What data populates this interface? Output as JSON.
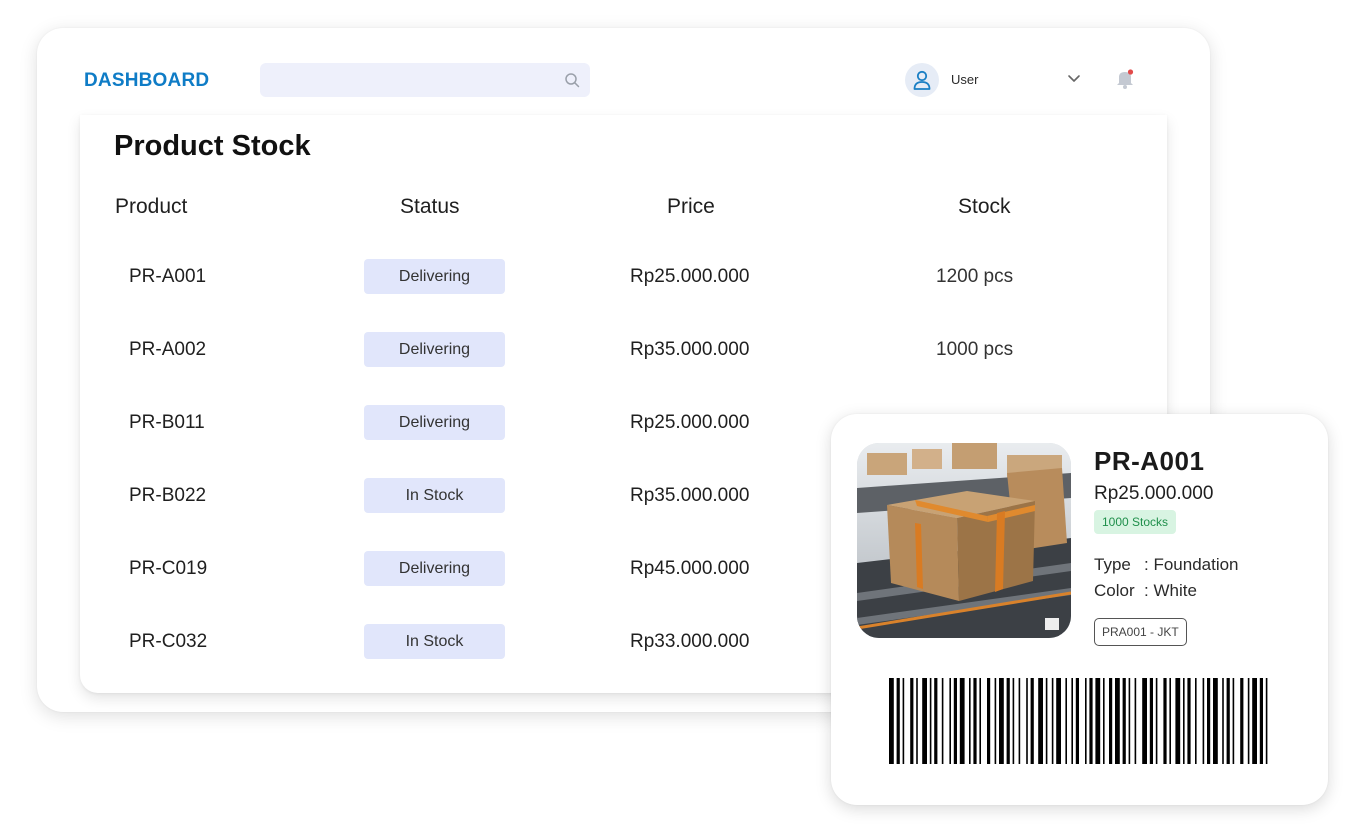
{
  "header": {
    "brand": "DASHBOARD",
    "search_placeholder": "",
    "user_name": "User"
  },
  "table": {
    "title": "Product Stock",
    "columns": [
      "Product",
      "Status",
      "Price",
      "Stock"
    ],
    "rows": [
      {
        "product": "PR-A001",
        "status": "Delivering",
        "price": "Rp25.000.000",
        "stock": "1200 pcs"
      },
      {
        "product": "PR-A002",
        "status": "Delivering",
        "price": "Rp35.000.000",
        "stock": "1000 pcs"
      },
      {
        "product": "PR-B011",
        "status": "Delivering",
        "price": "Rp25.000.000",
        "stock": ""
      },
      {
        "product": "PR-B022",
        "status": "In Stock",
        "price": "Rp35.000.000",
        "stock": ""
      },
      {
        "product": "PR-C019",
        "status": "Delivering",
        "price": "Rp45.000.000",
        "stock": ""
      },
      {
        "product": "PR-C032",
        "status": "In Stock",
        "price": "Rp33.000.000",
        "stock": ""
      }
    ]
  },
  "detail": {
    "code": "PR-A001",
    "price": "Rp25.000.000",
    "stocks_badge": "1000 Stocks",
    "type_label": "Type",
    "type_value": ": Foundation",
    "color_label": "Color",
    "color_value": ": White",
    "sku": "PRA001  - JKT"
  },
  "colors": {
    "brand": "#0f7cc6",
    "status_badge_bg": "#e1e6fb",
    "stock_badge_bg": "#d8f4e2",
    "stock_badge_text": "#1f8f4b",
    "notification_dot": "#e24a4a"
  },
  "icons": [
    "search-icon",
    "user-icon",
    "chevron-down-icon",
    "bell-icon"
  ]
}
